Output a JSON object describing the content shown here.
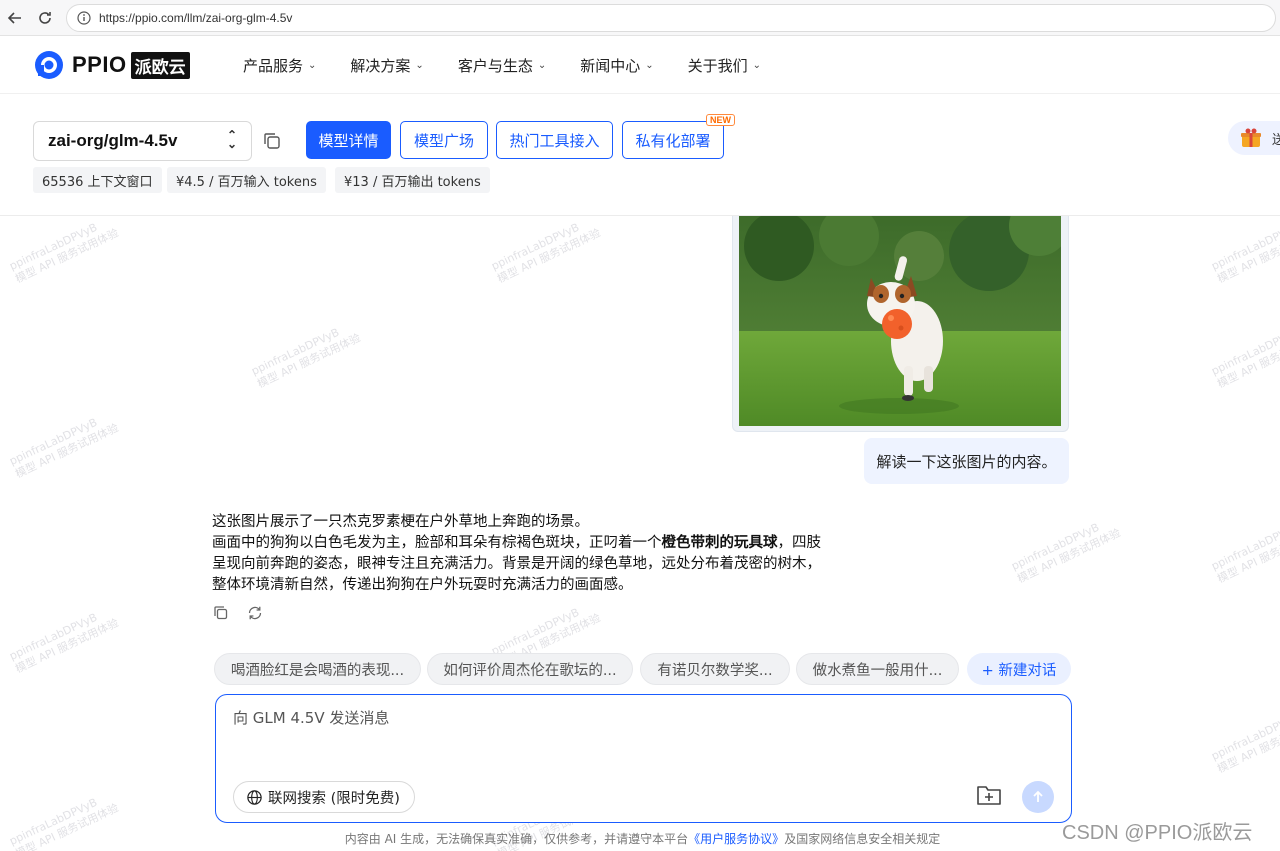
{
  "browser": {
    "url": "https://ppio.com/llm/zai-org-glm-4.5v"
  },
  "header": {
    "logo_text": "PPIO",
    "logo_cn": "派欧云",
    "nav": [
      {
        "label": "产品服务"
      },
      {
        "label": "解决方案"
      },
      {
        "label": "客户与生态"
      },
      {
        "label": "新闻中心"
      },
      {
        "label": "关于我们"
      }
    ]
  },
  "model": {
    "name": "zai-org/glm-4.5v",
    "tabs": [
      "模型详情",
      "模型广场",
      "热门工具接入",
      "私有化部署"
    ],
    "new_badge": "NEW",
    "chips": [
      "65536 上下文窗口",
      "¥4.5 / 百万输入 tokens",
      "¥13 / 百万输出 tokens"
    ],
    "gift_label": "送"
  },
  "chat": {
    "user_message": "解读一下这张图片的内容。",
    "answer_line1": "这张图片展示了一只杰克罗素梗在户外草地上奔跑的场景。",
    "answer_line2_pre": "画面中的狗狗以白色毛发为主，脸部和耳朵有棕褐色斑块，正叼着一个",
    "answer_line2_bold": "橙色带刺的玩具球",
    "answer_line2_post": "，四肢呈现向前奔跑的姿态，眼神专注且充满活力。背景是开阔的绿色草地，远处分布着茂密的树木，整体环境清新自然，传递出狗狗在户外玩耍时充满活力的画面感。",
    "suggestions": [
      "喝酒脸红是会喝酒的表现...",
      "如何评价周杰伦在歌坛的...",
      "有诺贝尔数学奖...",
      "做水煮鱼一般用什..."
    ],
    "new_chat": "+ 新建对话",
    "input_placeholder": "向 GLM 4.5V 发送消息",
    "web_search": "联网搜索 (限时免费)"
  },
  "footer": {
    "pre": "内容由 AI 生成，无法确保真实准确，仅供参考，并请遵守本平台",
    "link": "《用户服务协议》",
    "post": "及国家网络信息安全相关规定"
  },
  "watermark": {
    "line1": "ppinfraLabDPVyB",
    "line2": "模型 API 服务试用体验"
  },
  "csdn_watermark": "CSDN @PPIO派欧云",
  "colors": {
    "accent": "#1a5cff",
    "user_bubble": "#eef3ff"
  }
}
